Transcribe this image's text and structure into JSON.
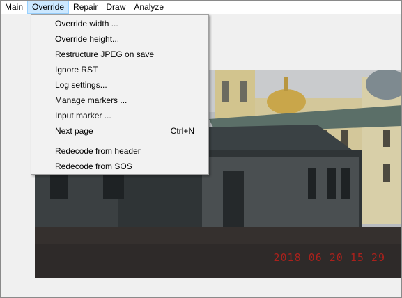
{
  "menubar": {
    "items": [
      {
        "label": "Main"
      },
      {
        "label": "Override"
      },
      {
        "label": "Repair"
      },
      {
        "label": "Draw"
      },
      {
        "label": "Analyze"
      }
    ],
    "active_index": 1
  },
  "override_menu": {
    "items": [
      {
        "label": "Override width ..."
      },
      {
        "label": "Override height..."
      },
      {
        "label": "Restructure JPEG on save"
      },
      {
        "label": "Ignore RST"
      },
      {
        "label": "Log settings..."
      },
      {
        "label": "Manage markers ..."
      },
      {
        "label": "Input marker ..."
      },
      {
        "label": "Next page",
        "shortcut": "Ctrl+N"
      },
      {
        "label": "Redecode from header"
      },
      {
        "label": "Redecode from SOS"
      }
    ]
  },
  "image": {
    "timestamp": "2018 06 20 15 29"
  },
  "colors": {
    "menu_highlight": "#cce8ff",
    "menu_highlight_border": "#99d1ff",
    "timestamp": "#c0201a"
  }
}
